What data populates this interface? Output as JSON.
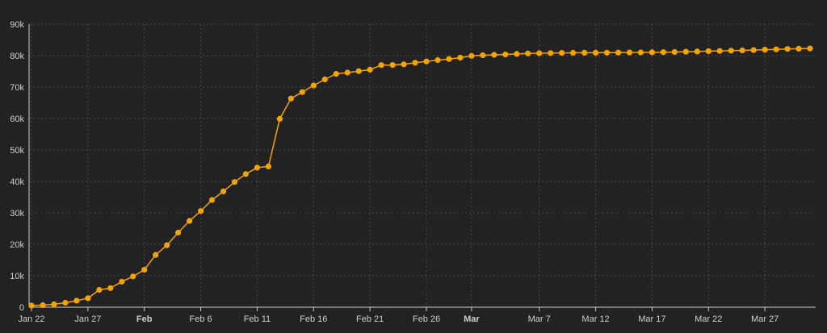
{
  "colors": {
    "background": "#222222",
    "grid": "#4a4a4a",
    "axis": "#cfcfcf",
    "series": "#f5a300"
  },
  "chart_data": {
    "type": "line",
    "title": "",
    "xlabel": "",
    "ylabel": "",
    "ylim": [
      0,
      90000
    ],
    "y_ticks": [
      0,
      10000,
      20000,
      30000,
      40000,
      50000,
      60000,
      70000,
      80000,
      90000
    ],
    "y_tick_labels": [
      "0",
      "10k",
      "20k",
      "30k",
      "40k",
      "50k",
      "60k",
      "70k",
      "80k",
      "90k"
    ],
    "x_range": [
      "2020-01-22",
      "2020-03-31"
    ],
    "x_ticks": [
      {
        "date": "2020-01-22",
        "label": "Jan 22",
        "bold": false
      },
      {
        "date": "2020-01-27",
        "label": "Jan 27",
        "bold": false
      },
      {
        "date": "2020-02-01",
        "label": "Feb",
        "bold": true
      },
      {
        "date": "2020-02-06",
        "label": "Feb 6",
        "bold": false
      },
      {
        "date": "2020-02-11",
        "label": "Feb 11",
        "bold": false
      },
      {
        "date": "2020-02-16",
        "label": "Feb 16",
        "bold": false
      },
      {
        "date": "2020-02-21",
        "label": "Feb 21",
        "bold": false
      },
      {
        "date": "2020-02-26",
        "label": "Feb 26",
        "bold": false
      },
      {
        "date": "2020-03-01",
        "label": "Mar",
        "bold": true
      },
      {
        "date": "2020-03-07",
        "label": "Mar 7",
        "bold": false
      },
      {
        "date": "2020-03-12",
        "label": "Mar 12",
        "bold": false
      },
      {
        "date": "2020-03-17",
        "label": "Mar 17",
        "bold": false
      },
      {
        "date": "2020-03-22",
        "label": "Mar 22",
        "bold": false
      },
      {
        "date": "2020-03-27",
        "label": "Mar 27",
        "bold": false
      }
    ],
    "grid": true,
    "legend": "none",
    "series": [
      {
        "x": [
          "2020-01-22",
          "2020-01-23",
          "2020-01-24",
          "2020-01-25",
          "2020-01-26",
          "2020-01-27",
          "2020-01-28",
          "2020-01-29",
          "2020-01-30",
          "2020-01-31",
          "2020-02-01",
          "2020-02-02",
          "2020-02-03",
          "2020-02-04",
          "2020-02-05",
          "2020-02-06",
          "2020-02-07",
          "2020-02-08",
          "2020-02-09",
          "2020-02-10",
          "2020-02-11",
          "2020-02-12",
          "2020-02-13",
          "2020-02-14",
          "2020-02-15",
          "2020-02-16",
          "2020-02-17",
          "2020-02-18",
          "2020-02-19",
          "2020-02-20",
          "2020-02-21",
          "2020-02-22",
          "2020-02-23",
          "2020-02-24",
          "2020-02-25",
          "2020-02-26",
          "2020-02-27",
          "2020-02-28",
          "2020-02-29",
          "2020-03-01",
          "2020-03-02",
          "2020-03-03",
          "2020-03-04",
          "2020-03-05",
          "2020-03-06",
          "2020-03-07",
          "2020-03-08",
          "2020-03-09",
          "2020-03-10",
          "2020-03-11",
          "2020-03-12",
          "2020-03-13",
          "2020-03-14",
          "2020-03-15",
          "2020-03-16",
          "2020-03-17",
          "2020-03-18",
          "2020-03-19",
          "2020-03-20",
          "2020-03-21",
          "2020-03-22",
          "2020-03-23",
          "2020-03-24",
          "2020-03-25",
          "2020-03-26",
          "2020-03-27",
          "2020-03-28",
          "2020-03-29",
          "2020-03-30",
          "2020-03-31"
        ],
        "values": [
          548,
          643,
          920,
          1406,
          2075,
          2877,
          5509,
          6087,
          8141,
          9802,
          11891,
          16630,
          19716,
          23707,
          27440,
          30587,
          34110,
          36814,
          39829,
          42354,
          44386,
          44759,
          59895,
          66358,
          68413,
          70513,
          72434,
          74211,
          74619,
          75077,
          75550,
          77001,
          77022,
          77241,
          77754,
          78166,
          78600,
          78928,
          79356,
          79932,
          80136,
          80261,
          80386,
          80537,
          80690,
          80770,
          80823,
          80860,
          80887,
          80921,
          80932,
          80945,
          80977,
          81003,
          81033,
          81058,
          81102,
          81156,
          81250,
          81305,
          81435,
          81498,
          81591,
          81661,
          81782,
          81897,
          81999,
          82122,
          82198,
          82279
        ]
      }
    ]
  }
}
